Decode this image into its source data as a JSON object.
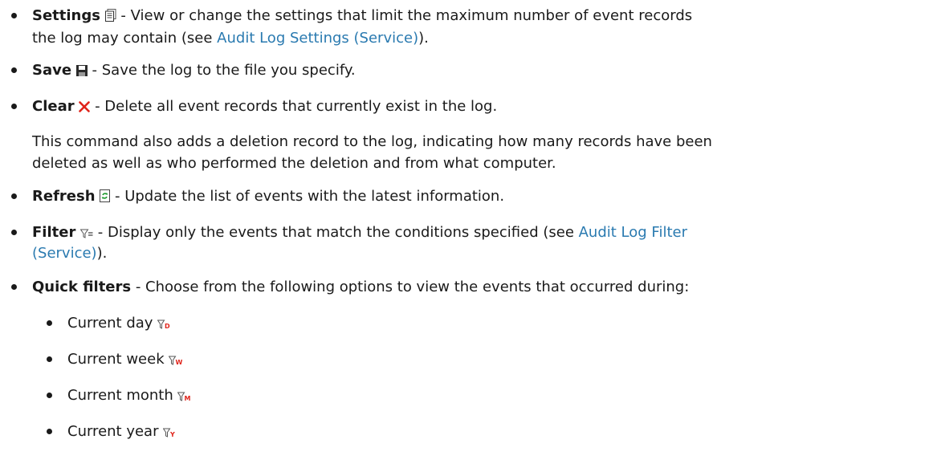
{
  "items": {
    "settings": {
      "term": "Settings",
      "icon": "settings-properties-icon",
      "desc_line1": " - View or change the settings that limit the maximum number of event records",
      "desc_line2_pre": "the log may contain (see ",
      "link": "Audit Log Settings (Service)",
      "desc_line2_post": ")."
    },
    "save": {
      "term": "Save",
      "icon": "save-disk-icon",
      "desc": " - Save the log to the file you specify."
    },
    "clear": {
      "term": "Clear",
      "icon": "clear-x-icon",
      "desc": " - Delete all event records that currently exist in the log.",
      "note_line1": "This command also adds a deletion record to the log, indicating how many records have been",
      "note_line2": "deleted as well as who performed the deletion and from what computer."
    },
    "refresh": {
      "term": "Refresh",
      "icon": "refresh-icon",
      "desc": " - Update the list of events with the latest information."
    },
    "filter": {
      "term": "Filter",
      "icon": "filter-icon",
      "desc_line1": " - Display only the events that match the conditions specified (see ",
      "link_line1": "Audit Log Filter",
      "link_line2": "(Service)",
      "desc_line2_post": ")."
    },
    "quick_filters": {
      "term": "Quick filters",
      "desc": " - Choose from the following options to view the events that occurred during:",
      "options": [
        {
          "label": "Current day",
          "icon": "filter-day-icon",
          "letter": "D"
        },
        {
          "label": "Current week",
          "icon": "filter-week-icon",
          "letter": "W"
        },
        {
          "label": "Current month",
          "icon": "filter-month-icon",
          "letter": "M"
        },
        {
          "label": "Current year",
          "icon": "filter-year-icon",
          "letter": "Y"
        }
      ]
    }
  },
  "colors": {
    "text": "#1a1a1a",
    "link": "#2a7ab0",
    "clear_icon": "#e0241b",
    "quick_filter_letter": "#e0241b"
  }
}
